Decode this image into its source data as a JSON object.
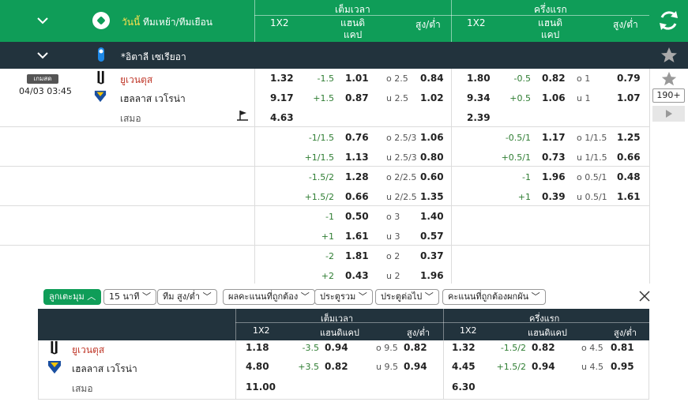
{
  "header": {
    "today_label": "วันนี้",
    "sort_label": "ทีมเหย้า/ทีมเยือน",
    "fulltime_label": "เต็มเวลา",
    "halftime_label": "ครึ่งแรก",
    "col_1x2": "1X2",
    "col_handicap_line1": "แฮนดิ",
    "col_handicap_line2": "แคป",
    "col_ou": "สูง/ต่ำ"
  },
  "league": {
    "name": "*อิตาลี เซเรียอา"
  },
  "match": {
    "status_badge": "เกมสด",
    "datetime": "04/03 03:45",
    "home": "ยูเวนตุส",
    "away": "เฮลลาส เวโรน่า",
    "draw": "เสมอ",
    "more_count": "190+"
  },
  "main_rows": [
    {
      "ft_1x2": [
        "1.32",
        "9.17",
        "4.63"
      ],
      "ft_hc": [
        [
          "-1.5",
          "1.01"
        ],
        [
          "+1.5",
          "0.87"
        ]
      ],
      "ft_ou": [
        [
          "o 2.5",
          "0.84"
        ],
        [
          "u 2.5",
          "1.02"
        ]
      ],
      "ht_1x2": [
        "1.80",
        "9.34",
        "2.39"
      ],
      "ht_hc": [
        [
          "-0.5",
          "0.82"
        ],
        [
          "+0.5",
          "1.06"
        ]
      ],
      "ht_ou": [
        [
          "o 1",
          "0.79"
        ],
        [
          "u 1",
          "1.07"
        ]
      ]
    },
    {
      "ft_hc": [
        [
          "-1/1.5",
          "0.76"
        ],
        [
          "+1/1.5",
          "1.13"
        ]
      ],
      "ft_ou": [
        [
          "o 2.5/3",
          "1.06"
        ],
        [
          "u 2.5/3",
          "0.80"
        ]
      ],
      "ht_hc": [
        [
          "-0.5/1",
          "1.17"
        ],
        [
          "+0.5/1",
          "0.73"
        ]
      ],
      "ht_ou": [
        [
          "o 1/1.5",
          "1.25"
        ],
        [
          "u 1/1.5",
          "0.66"
        ]
      ]
    },
    {
      "ft_hc": [
        [
          "-1.5/2",
          "1.28"
        ],
        [
          "+1.5/2",
          "0.66"
        ]
      ],
      "ft_ou": [
        [
          "o 2/2.5",
          "0.60"
        ],
        [
          "u 2/2.5",
          "1.35"
        ]
      ],
      "ht_hc": [
        [
          "-1",
          "1.96"
        ],
        [
          "+1",
          "0.39"
        ]
      ],
      "ht_ou": [
        [
          "o 0.5/1",
          "0.48"
        ],
        [
          "u 0.5/1",
          "1.61"
        ]
      ]
    },
    {
      "ft_hc": [
        [
          "-1",
          "0.50"
        ],
        [
          "+1",
          "1.61"
        ]
      ],
      "ft_ou": [
        [
          "o 3",
          "1.40"
        ],
        [
          "u 3",
          "0.57"
        ]
      ]
    },
    {
      "ft_hc": [
        [
          "-2",
          "1.81"
        ],
        [
          "+2",
          "0.43"
        ]
      ],
      "ft_ou": [
        [
          "o 2",
          "0.37"
        ],
        [
          "u 2",
          "1.96"
        ]
      ]
    }
  ],
  "filters": {
    "more": "ลูกเตะมุม",
    "f1": "15 นาที",
    "f2": "ทีม สูง/ต่ำ",
    "f3": "ผลคะแนนที่ถูกต้อง",
    "f4": "ประตูรวม",
    "f5": "ประตูต่อไป",
    "f6": "คะแนนที่ถูกต้องผกผัน"
  },
  "sub": {
    "fulltime_label": "เต็มเวลา",
    "halftime_label": "ครึ่งแรก",
    "col_1x2": "1X2",
    "col_handicap": "แฮนดิแคป",
    "col_ou": "สูง/ต่ำ",
    "home": "ยูเวนตุส",
    "away": "เฮลลาส เวโรน่า",
    "draw": "เสมอ",
    "ft_1x2": [
      "1.18",
      "4.80",
      "11.00"
    ],
    "ft_hc": [
      [
        "-3.5",
        "0.94"
      ],
      [
        "+3.5",
        "0.82"
      ]
    ],
    "ft_ou": [
      [
        "o 9.5",
        "0.82"
      ],
      [
        "u 9.5",
        "0.94"
      ]
    ],
    "ht_1x2": [
      "1.32",
      "4.45",
      "6.30"
    ],
    "ht_hc": [
      [
        "-1.5/2",
        "0.82"
      ],
      [
        "+1.5/2",
        "0.94"
      ]
    ],
    "ht_ou": [
      [
        "o 4.5",
        "0.81"
      ],
      [
        "u 4.5",
        "0.95"
      ]
    ]
  },
  "colors": {
    "brand_green": "#0f9d58",
    "dark_bar": "#22333d",
    "home_red": "#c0392b",
    "accent_yellow": "#ffe14d"
  },
  "icons": [
    "chevron-down-icon",
    "football-icon",
    "refresh-icon",
    "serie-a-logo",
    "star-icon",
    "play-icon",
    "corner-flag-icon",
    "close-icon",
    "juventus-logo",
    "verona-logo"
  ]
}
